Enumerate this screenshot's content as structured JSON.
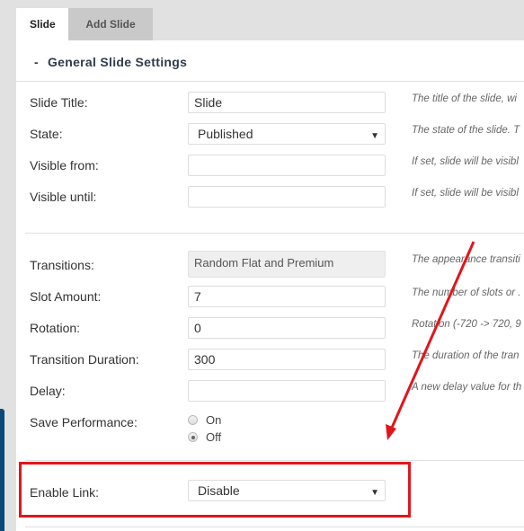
{
  "tabs": [
    {
      "label": "Slide",
      "active": true
    },
    {
      "label": "Add Slide",
      "active": false
    }
  ],
  "section": {
    "toggle": "-",
    "title": "General Slide Settings"
  },
  "fields": {
    "slide_title": {
      "label": "Slide Title:",
      "value": "Slide",
      "desc": "The title of the slide, wi"
    },
    "state": {
      "label": "State:",
      "value": "Published",
      "desc": "The state of the slide. T"
    },
    "visible_from": {
      "label": "Visible from:",
      "value": "",
      "desc": "If set, slide will be visibl"
    },
    "visible_until": {
      "label": "Visible until:",
      "value": "",
      "desc": "If set, slide will be visibl"
    },
    "transitions": {
      "label": "Transitions:",
      "value": "Random Flat and Premium",
      "desc": "The appearance transiti"
    },
    "slot_amount": {
      "label": "Slot Amount:",
      "value": "7",
      "desc": "The number of slots or ."
    },
    "rotation": {
      "label": "Rotation:",
      "value": "0",
      "desc": "Rotation (-720 -> 720, 9"
    },
    "transition_duration": {
      "label": "Transition Duration:",
      "value": "300",
      "desc": "The duration of the tran"
    },
    "delay": {
      "label": "Delay:",
      "value": "",
      "desc": "A new delay value for th"
    },
    "save_performance": {
      "label": "Save Performance:",
      "options": [
        "On",
        "Off"
      ],
      "selected": "Off"
    },
    "enable_link": {
      "label": "Enable Link:",
      "value": "Disable"
    }
  },
  "annotation": {
    "highlight_color": "#e0161b"
  }
}
